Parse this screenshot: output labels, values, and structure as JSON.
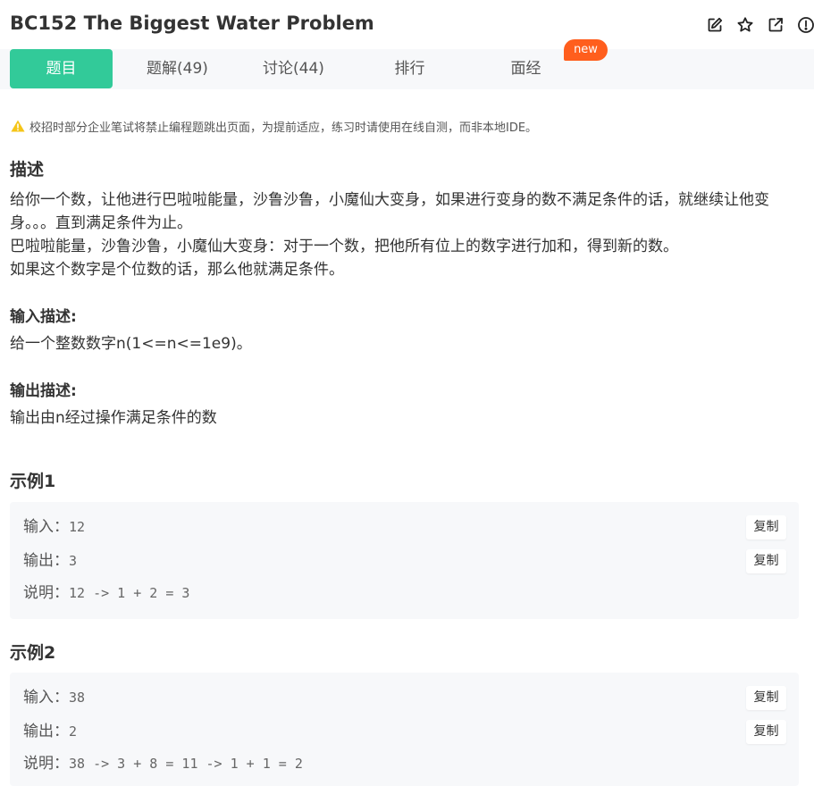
{
  "problem": {
    "title": "BC152  The Biggest Water Problem"
  },
  "title_actions": [
    {
      "icon": "edit-icon"
    },
    {
      "icon": "star-icon"
    },
    {
      "icon": "share-icon"
    },
    {
      "icon": "report-icon"
    }
  ],
  "tabs": [
    {
      "label": "题目",
      "active": true
    },
    {
      "label": "题解(49)",
      "active": false
    },
    {
      "label": "讨论(44)",
      "active": false
    },
    {
      "label": "排行",
      "active": false
    },
    {
      "label": "面经",
      "active": false
    }
  ],
  "new_badge": "new",
  "notice": {
    "icon": "warning-icon",
    "text": "校招时部分企业笔试将禁止编程题跳出页面，为提前适应，练习时请使用在线自测，而非本地IDE。"
  },
  "description": {
    "heading": "描述",
    "lines": [
      "给你一个数，让他进行巴啦啦能量，沙鲁沙鲁，小魔仙大变身，如果进行变身的数不满足条件的话，就继续让他变身。。。直到满足条件为止。",
      "巴啦啦能量，沙鲁沙鲁，小魔仙大变身：对于一个数，把他所有位上的数字进行加和，得到新的数。",
      "如果这个数字是个位数的话，那么他就满足条件。"
    ]
  },
  "input_desc": {
    "heading": "输入描述:",
    "text": "给一个整数数字n(1<=n<=1e9)。"
  },
  "output_desc": {
    "heading": "输出描述:",
    "text": "输出由n经过操作满足条件的数"
  },
  "examples": [
    {
      "heading": "示例1",
      "input_label": "输入：",
      "input": "12",
      "output_label": "输出：",
      "output": "3",
      "explain_label": "说明：",
      "explain": "12 -> 1 + 2 = 3",
      "copy_label": "复制"
    },
    {
      "heading": "示例2",
      "input_label": "输入：",
      "input": "38",
      "output_label": "输出：",
      "output": "2",
      "explain_label": "说明：",
      "explain": "38 -> 3 + 8 = 11 -> 1 + 1 = 2",
      "copy_label": "复制"
    }
  ],
  "colors": {
    "accent": "#32ca99",
    "badge": "#ff5e1d",
    "warning": "#f5c518",
    "tab_bar_bg": "#f7f8fa",
    "example_bg": "#f7f8fa"
  }
}
